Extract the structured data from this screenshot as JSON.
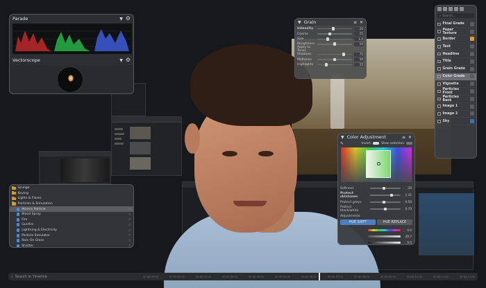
{
  "parade": {
    "title": "Parade"
  },
  "vectorscope": {
    "title": "Vectorscope"
  },
  "grain": {
    "title": "Grain",
    "params": [
      {
        "label": "Intensity",
        "value": "20",
        "pos": 0.45,
        "bold": true
      },
      {
        "label": "Coarse",
        "value": "25",
        "pos": 0.35
      },
      {
        "label": "Size",
        "value": "1.0",
        "pos": 0.3
      },
      {
        "label": "Roughness",
        "value": "50",
        "pos": 0.5
      },
      {
        "label": "Apply to Tones",
        "value": "",
        "pos": null
      },
      {
        "label": "Shadows",
        "value": "75",
        "pos": 0.75
      },
      {
        "label": "Midtones",
        "value": "50",
        "pos": 0.5
      },
      {
        "label": "Highlights",
        "value": "25",
        "pos": 0.25
      }
    ]
  },
  "node_list": {
    "search_placeholder": "Search...",
    "items": [
      {
        "label": "Final Grade",
        "swatch": "#5a5c60",
        "active": false
      },
      {
        "label": "Paper Texture",
        "swatch": "#5a5c60",
        "active": false
      },
      {
        "label": "Border",
        "swatch": "#e39b2d",
        "active": false
      },
      {
        "label": "Text",
        "swatch": "#5a5c60",
        "active": false
      },
      {
        "label": "Headline",
        "swatch": "#5a5c60",
        "active": false
      },
      {
        "label": "Title",
        "swatch": "#5a5c60",
        "active": false
      },
      {
        "label": "Grain Grade",
        "swatch": "#5a5c60",
        "active": false
      },
      {
        "label": "Color Grade",
        "swatch": "#5a5c60",
        "active": true
      },
      {
        "label": "Vignette",
        "swatch": "#5a5c60",
        "active": false
      },
      {
        "label": "Particles Front",
        "swatch": "#5a5c60",
        "active": false
      },
      {
        "label": "Particles Back",
        "swatch": "#5a5c60",
        "active": false
      },
      {
        "label": "Image 1",
        "swatch": "#5a5c60",
        "active": false
      },
      {
        "label": "Image 2",
        "swatch": "#5a5c60",
        "active": false
      },
      {
        "label": "Sky",
        "swatch": "#3a6fb2",
        "active": false
      }
    ]
  },
  "color_adjustment": {
    "title": "Color Adjustment",
    "invert_label": "Invert",
    "view_selection_label": "View selection",
    "rows": [
      {
        "label": "Softness",
        "value": "20",
        "bold": false
      },
      {
        "label": "Protect skintones",
        "value": "1.31",
        "bold": true
      },
      {
        "label": "Protect greys",
        "value": "0.50",
        "bold": false
      },
      {
        "label": "Protect black/white",
        "value": "0.70",
        "bold": false
      }
    ],
    "adjustments_label": "Adjustments",
    "hue_shift_label": "HUE SHIFT",
    "hue_replace_label": "HUE REPLACE",
    "outputs": [
      "0.0",
      "26.7",
      "0.0"
    ]
  },
  "effects": {
    "items": [
      {
        "label": "Grunge",
        "type": "folder"
      },
      {
        "label": "Keying",
        "type": "folder"
      },
      {
        "label": "Lights & Flares",
        "type": "folder"
      },
      {
        "label": "Particles & Simulation",
        "type": "folder"
      },
      {
        "label": "Atomic Particle",
        "type": "file",
        "selected": true
      },
      {
        "label": "Blood Spray",
        "type": "file"
      },
      {
        "label": "Fire",
        "type": "file"
      },
      {
        "label": "Gunfire",
        "type": "file"
      },
      {
        "label": "Lightning & Electricity",
        "type": "file"
      },
      {
        "label": "Particle Simulator",
        "type": "file"
      },
      {
        "label": "Rain On Glass",
        "type": "file"
      },
      {
        "label": "Shatter",
        "type": "file"
      }
    ]
  },
  "timeline": {
    "search_placeholder": "Search in Timeline",
    "timecodes": [
      "00:00:00:00",
      "00:00:01:00",
      "00:00:02:00",
      "00:00:03:00",
      "00:00:04:00",
      "00:00:05:00",
      "00:00:06:00",
      "00:00:07:00",
      "00:00:08:00",
      "00:00:09:00",
      "00:00:10:00",
      "00:00:11:00",
      "00:00:12:00"
    ]
  },
  "colors": {
    "accent": "#4d7fbf",
    "folder": "#d89a2b",
    "bg": "#17181b"
  }
}
